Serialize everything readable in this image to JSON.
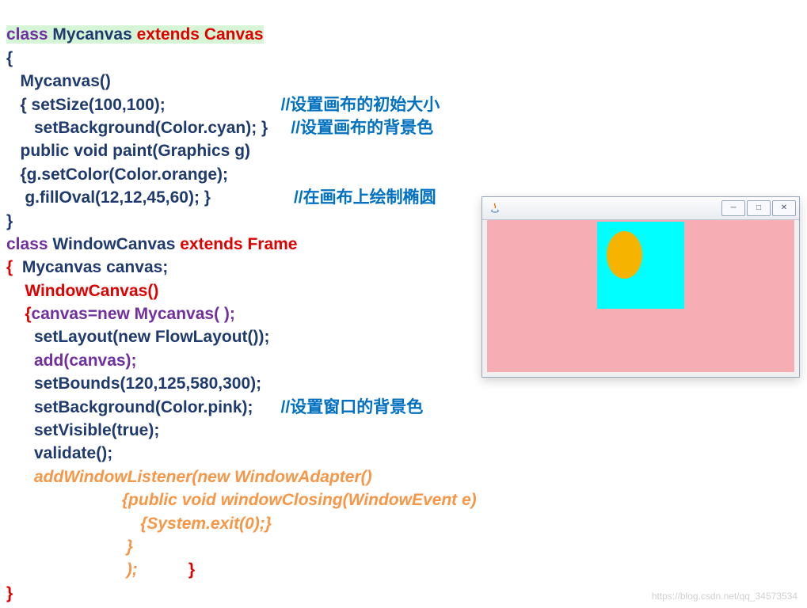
{
  "code": {
    "l1a": "class ",
    "l1b": "Mycanvas ",
    "l1c": "extends ",
    "l1d": "Canvas",
    "l2": "{",
    "l3": "   Mycanvas()",
    "l4a": "   { setSize(100,100);                         ",
    "l4b": "//设置画布的初始大小",
    "l5a": "      setBackground(Color.cyan); }     ",
    "l5b": "//设置画布的背景色",
    "l6": "   public void paint(Graphics g)",
    "l7": "   {g.setColor(Color.orange);",
    "l8a": "    g.fillOval(12,12,45,60); }                  ",
    "l8b": "//在画布上绘制椭圆",
    "l9": "}",
    "l10a": "class ",
    "l10b": "WindowCanvas ",
    "l10c": "extends ",
    "l10d": "Frame",
    "l11a": "{  ",
    "l11b": "Mycanvas canvas;",
    "l12": "    WindowCanvas()",
    "l13a": "    {",
    "l13b": "canvas=new Mycanvas( );",
    "l14": "      setLayout(new FlowLayout());",
    "l15": "      add(canvas);",
    "l16": "      setBounds(120,125,580,300);",
    "l17a": "      setBackground(Color.pink);      ",
    "l17b": "//设置窗口的背景色",
    "l18": "      setVisible(true);",
    "l19": "      validate();",
    "l20": "      addWindowListener(new WindowAdapter()",
    "l21": "                         {public void windowClosing(WindowEvent e)",
    "l22": "                             {System.exit(0);}",
    "l23": "                          }",
    "l24a": "                          ); ",
    "l24b": "          }",
    "l25": "}"
  },
  "window": {
    "minimize": "─",
    "maximize": "□",
    "close": "✕"
  },
  "watermark": "https://blog.csdn.net/qq_34573534"
}
